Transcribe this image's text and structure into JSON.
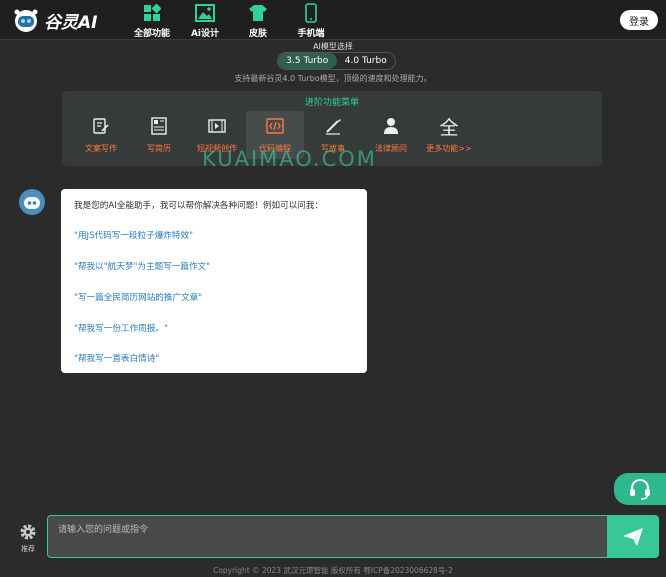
{
  "header": {
    "logo_text": "谷灵AI",
    "nav": [
      {
        "label": "全部功能",
        "icon": "grid-icon"
      },
      {
        "label": "Ai设计",
        "icon": "image-icon"
      },
      {
        "label": "皮肤",
        "icon": "shirt-icon"
      },
      {
        "label": "手机端",
        "icon": "phone-icon"
      }
    ],
    "login_label": "登录"
  },
  "model": {
    "title": "AI模型选择",
    "options": [
      "3.5 Turbo",
      "4.0 Turbo"
    ],
    "selected": "3.5 Turbo",
    "description": "支持最新谷灵4.0 Turbo模型，顶级的速度和处理能力。"
  },
  "advanced": {
    "title": "进阶功能菜单",
    "items": [
      {
        "label": "文案写作",
        "icon": "edit-doc-icon"
      },
      {
        "label": "写简历",
        "icon": "resume-icon"
      },
      {
        "label": "短视频创作",
        "icon": "film-icon"
      },
      {
        "label": "代码编程",
        "icon": "code-icon"
      },
      {
        "label": "写故事",
        "icon": "pen-icon"
      },
      {
        "label": "法律顾问",
        "icon": "person-icon"
      },
      {
        "label": "更多功能>>",
        "icon": "all-icon"
      }
    ],
    "active_index": 3
  },
  "watermark": "KUAIMAO.COM",
  "chat": {
    "intro": "我是您的AI全能助手，我可以帮你解决各种问题！例如可以问我：",
    "suggestions": [
      "\"用JS代码写一段粒子爆炸特效\"",
      "\"帮我以\"航天梦\"为主题写一篇作文\"",
      "\"写一篇全民简历网站的推广文章\"",
      "\"帮我写一份工作周报。\"",
      "\"帮我写一首表白情诗\""
    ]
  },
  "bottom": {
    "settings_label": "推荐",
    "input_placeholder": "请输入您的问题或指令",
    "footer": "Copyright © 2023 武汉元璟智能 版权所有 鄂ICP备2023006628号-2"
  },
  "colors": {
    "accent": "#38c896",
    "menu_label": "#ff7a3d",
    "link": "#2a7bbf",
    "header_bg": "#1f1f1f",
    "page_bg": "#2b2b2b"
  }
}
